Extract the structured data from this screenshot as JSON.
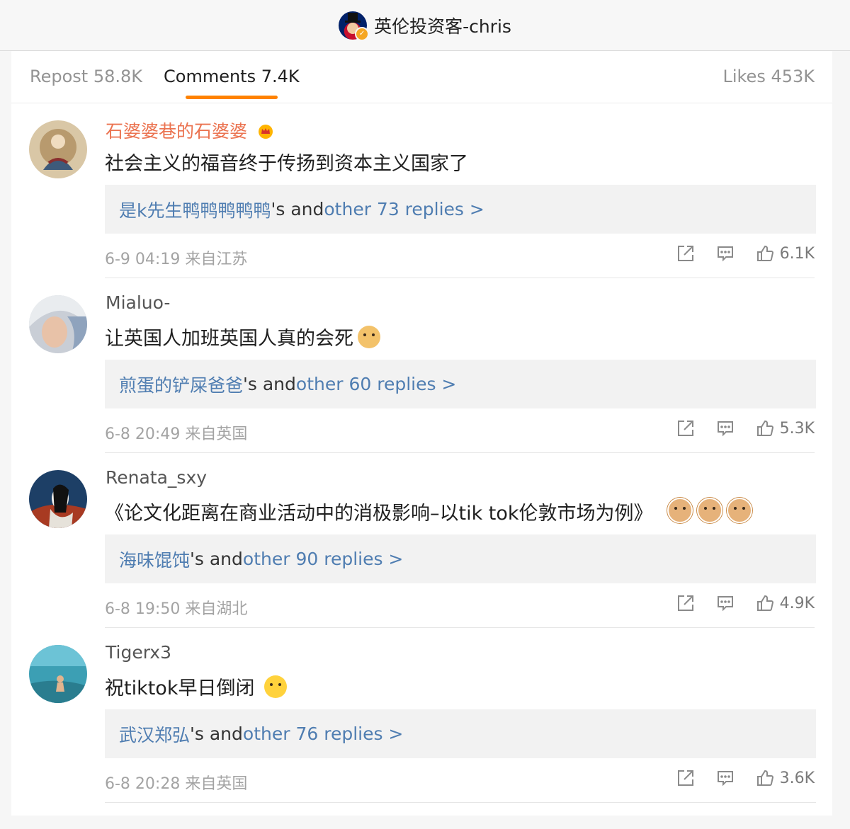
{
  "header": {
    "account_name": "英伦投资客-chris"
  },
  "tabs": {
    "repost": "Repost 58.8K",
    "comments": "Comments 7.4K",
    "likes": "Likes 453K",
    "active": "comments",
    "accent_color": "#ff8200"
  },
  "icons": {
    "share": "share-icon",
    "reply": "comment-icon",
    "like": "thumbs-up-icon",
    "badge": "crown-badge-icon"
  },
  "comments": [
    {
      "author": "石婆婆巷的石婆婆",
      "author_vip": true,
      "text": "社会主义的福音终于传扬到资本主义国家了",
      "replies_user": "是k先生鸭鸭鸭鸭鸭",
      "replies_mid": "'s and ",
      "replies_more": "other 73 replies >",
      "meta": "6-9 04:19 来自江苏",
      "likes": "6.1K"
    },
    {
      "author": "Mialuo-",
      "author_vip": false,
      "text": "让英国人加班英国人真的会死",
      "emoji": "doge",
      "replies_user": "煎蛋的铲屎爸爸",
      "replies_mid": "'s and ",
      "replies_more": "other 60 replies >",
      "meta": "6-8 20:49 来自英国",
      "likes": "5.3K"
    },
    {
      "author": "Renata_sxy",
      "author_vip": false,
      "text": "《论文化距离在商业活动中的消极影响–以tik tok伦敦市场为例》",
      "emoji": "cat",
      "replies_user": "海味馄饨",
      "replies_mid": "'s and ",
      "replies_more": "other 90 replies >",
      "meta": "6-8 19:50 来自湖北",
      "likes": "4.9K"
    },
    {
      "author": "Tigerx3",
      "author_vip": false,
      "text": "祝tiktok早日倒闭",
      "emoji": "cry",
      "replies_user": "武汉郑弘",
      "replies_mid": "'s and ",
      "replies_more": "other 76 replies >",
      "meta": "6-8 20:28 来自英国",
      "likes": "3.6K"
    }
  ]
}
